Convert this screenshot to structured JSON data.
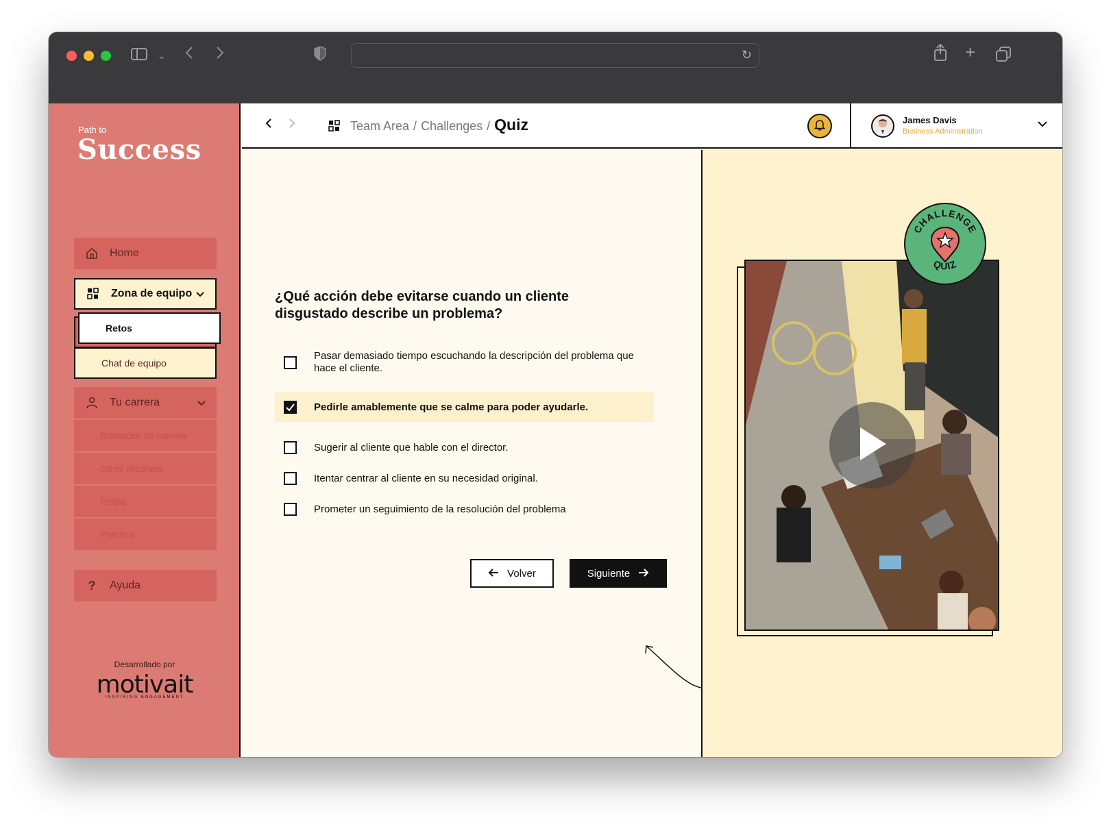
{
  "browser": {
    "lights": [
      "#ff5f57",
      "#febc2e",
      "#28c840"
    ]
  },
  "sidebar": {
    "brand_small": "Path to",
    "brand_big": "Success",
    "items": [
      {
        "label": "Home",
        "icon": "home-icon"
      },
      {
        "label": "Zona de equipo",
        "icon": "grid-icon",
        "active": true
      },
      {
        "label": "Tu carrera",
        "icon": "person-icon"
      },
      {
        "label": "Ayuda",
        "icon": "question-icon"
      }
    ],
    "team_sub": [
      {
        "label": "Retos",
        "active": true
      },
      {
        "label": "Chat de equipo"
      }
    ],
    "career_sub": [
      {
        "label": "Buscador de carrera"
      },
      {
        "label": "Otros recursos"
      },
      {
        "label": "Pistas"
      },
      {
        "label": "Practica"
      }
    ],
    "developed_by": "Desarrollado por",
    "dev_logo": "motivait",
    "dev_tagline": "INSPIRING ENGAGEMENT"
  },
  "topbar": {
    "breadcrumb": [
      "Team Area",
      "Challenges"
    ],
    "separator": "/",
    "current": "Quiz"
  },
  "user": {
    "name": "James Davis",
    "role": "Business Administration"
  },
  "quiz": {
    "question": "¿Qué acción debe evitarse cuando un cliente disgustado describe un problema?",
    "options": [
      {
        "text": "Pasar demasiado tiempo escuchando la descripción del problema que hace el cliente.",
        "checked": false
      },
      {
        "text": "Pedirle amablemente que se calme para poder ayudarle.",
        "checked": true
      },
      {
        "text": "Sugerir al cliente que hable con el director.",
        "checked": false
      },
      {
        "text": "Itentar centrar al cliente en su necesidad original.",
        "checked": false
      },
      {
        "text": "Prometer un seguimiento de la resolución del problema",
        "checked": false
      }
    ],
    "back_label": "Volver",
    "next_label": "Siguiente"
  },
  "media": {
    "badge_top": "CHALLENGE",
    "badge_bottom": "QUIZ"
  },
  "colors": {
    "sidebar": "#dc7b73",
    "accent_cream": "#fff3cf",
    "bell": "#e9b43b",
    "badge": "#5bb47a"
  }
}
